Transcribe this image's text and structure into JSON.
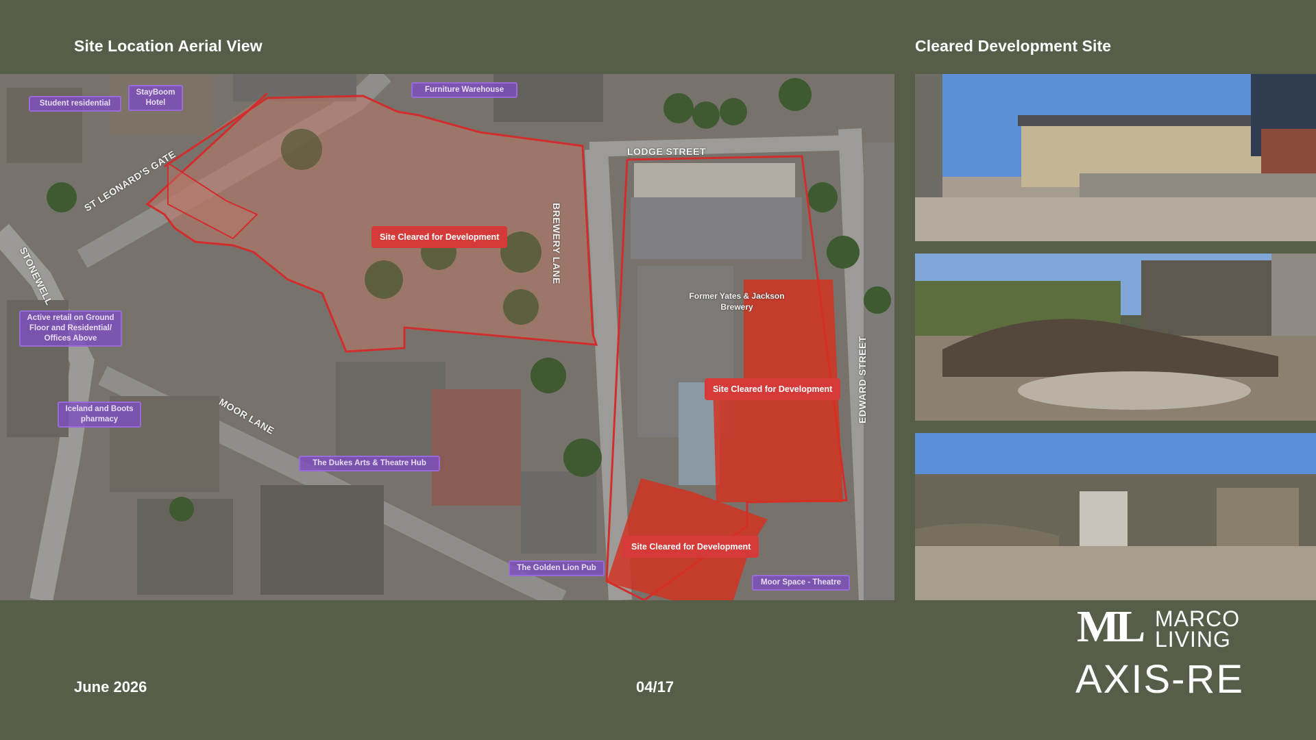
{
  "headings": {
    "aerial": "Site Location Aerial View",
    "photos": "Cleared Development Site"
  },
  "streets": {
    "lodge_street": "LODGE STREET",
    "brewery_lane": "BREWERY LANE",
    "st_leonards_gate": "ST LEONARD'S GATE",
    "stonewell": "STONEWELL",
    "moor_lane": "MOOR LANE",
    "edward_street": "EDWARD STREET"
  },
  "tags": {
    "student_residential": "Student residential",
    "stayboom_hotel": "StayBoom Hotel",
    "furniture_warehouse": "Furniture Warehouse",
    "active_retail": "Active retail on Ground Floor and Residential/ Offices Above",
    "iceland_boots": "Iceland and Boots pharmacy",
    "dukes_arts": "The Dukes Arts & Theatre Hub",
    "golden_lion": "The Golden Lion Pub",
    "moor_space": "Moor Space - Theatre"
  },
  "site_labels": {
    "left": "Site Cleared for Development",
    "right": "Site Cleared for Development",
    "bottom": "Site Cleared for Development"
  },
  "brewery_label": "Former Yates & Jackson Brewery",
  "footer": {
    "date": "June 2026",
    "page": "04/17"
  },
  "logo": {
    "brand_line1": "MARCO",
    "brand_line2": "LIVING",
    "brand_monogram": "ML",
    "brand_secondary": "AXIS-RE"
  },
  "colors": {
    "background": "#565e49",
    "site_highlight": "#d63a38",
    "tag_purple": "#7c4ebe"
  }
}
